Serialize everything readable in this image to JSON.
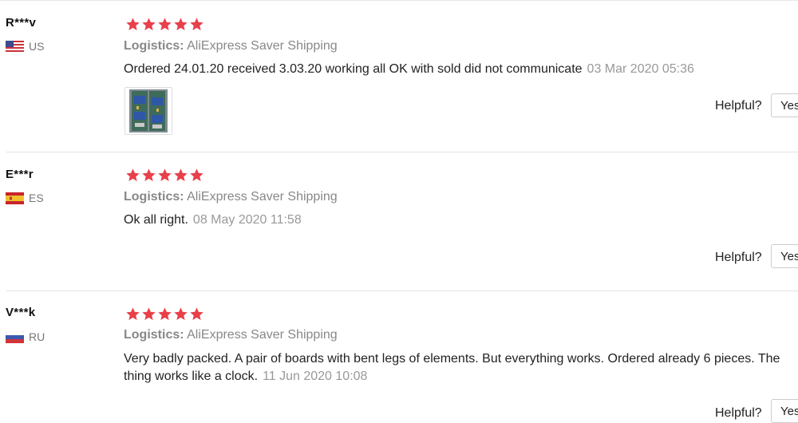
{
  "colors": {
    "star": "#e8404b",
    "muted": "#888888",
    "divider": "#e3e3e3"
  },
  "reviews": [
    {
      "user": "R***v",
      "country_code": "US",
      "flag_icon": "us-flag-icon",
      "rating": 5,
      "logistics_label": "Logistics:",
      "logistics_value": "AliExpress Saver Shipping",
      "text": "Ordered 24.01.20 received 3.03.20 working all OK with sold did not communicate",
      "date": "03 Mar 2020 05:36",
      "has_photo": true,
      "helpful_label": "Helpful?",
      "yes_label": "Yes"
    },
    {
      "user": "E***r",
      "country_code": "ES",
      "flag_icon": "es-flag-icon",
      "rating": 5,
      "logistics_label": "Logistics:",
      "logistics_value": "AliExpress Saver Shipping",
      "text": "Ok all right.",
      "date": "08 May 2020 11:58",
      "has_photo": false,
      "helpful_label": "Helpful?",
      "yes_label": "Yes"
    },
    {
      "user": "V***k",
      "country_code": "RU",
      "flag_icon": "ru-flag-icon",
      "rating": 5,
      "logistics_label": "Logistics:",
      "logistics_value": "AliExpress Saver Shipping",
      "text_line1": "Very badly packed. A pair of boards with bent legs of elements. But everything works. Ordered already 6 pieces. The",
      "text_line2": "thing works like a clock.",
      "date": "11 Jun 2020 10:08",
      "has_photo": false,
      "helpful_label": "Helpful?",
      "yes_label": "Yes"
    }
  ]
}
